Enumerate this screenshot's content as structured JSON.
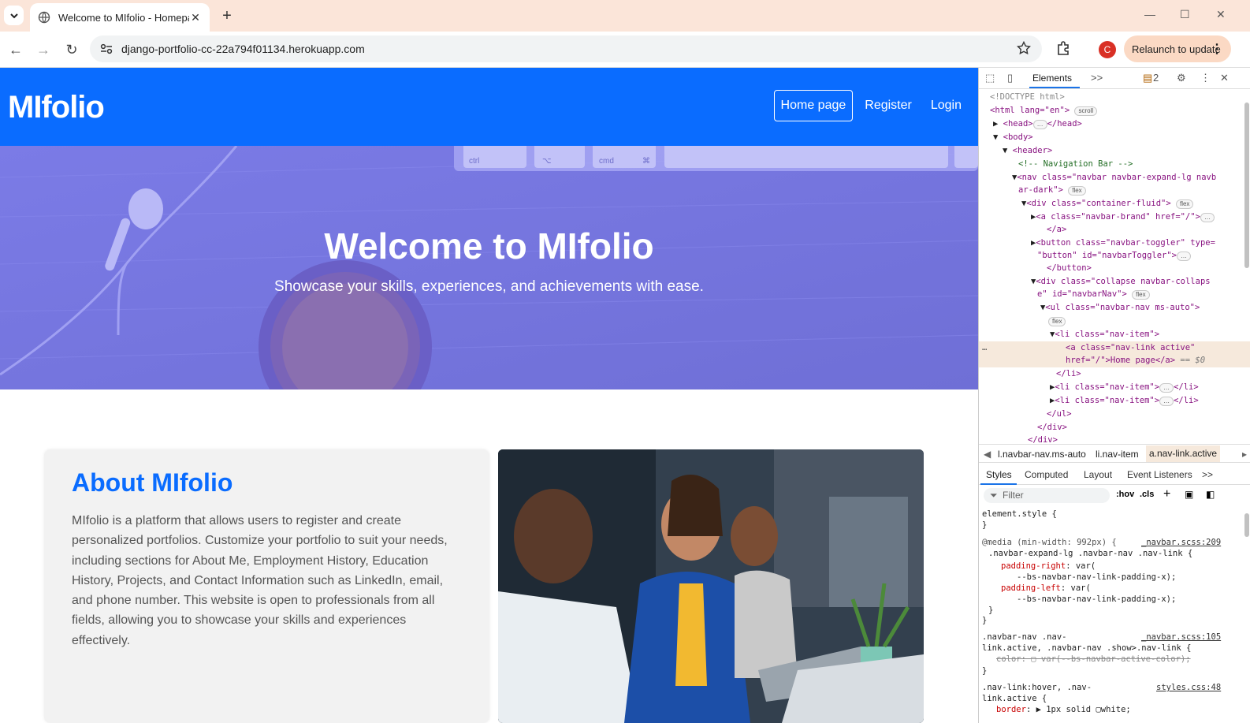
{
  "browser": {
    "tab_title": "Welcome to MIfolio - Homepag",
    "url": "django-portfolio-cc-22a794f01134.herokuapp.com",
    "relaunch_label": "Relaunch to update",
    "profile_initial": "C",
    "new_tab": "+",
    "close": "✕"
  },
  "site": {
    "brand": "MIfolio",
    "nav": [
      "Home page",
      "Register",
      "Login"
    ],
    "hero_title": "Welcome to MIfolio",
    "hero_subtitle": "Showcase your skills, experiences, and achievements with ease.",
    "about_title": "About MIfolio",
    "about_text": "MIfolio is a platform that allows users to register and create personalized portfolios. Customize your portfolio to suit your needs, including sections for About Me, Employment History, Education History, Projects, and Contact Information such as LinkedIn, email, and phone number. This website is open to professionals from all fields, allowing you to showcase your skills and experiences effectively."
  },
  "hero_keyboard": {
    "key1": "ctrl",
    "key2": "⌥",
    "key3": "cmd",
    "key3_symbol": "⌘"
  },
  "devtools": {
    "tab_elements": "Elements",
    "more": ">>",
    "issue_count": "2",
    "badges": {
      "scroll": "scroll",
      "flex": "flex"
    },
    "dom": {
      "doctype": "<!DOCTYPE html>",
      "html_open": "<html lang=\"en\">",
      "head": "<head>",
      "head_close": "</head>",
      "body": "<body>",
      "header": "<header>",
      "comment": "<!-- Navigation Bar -->",
      "nav_1": "<nav class=\"navbar navbar-expand-lg navb",
      "nav_2": "ar-dark\">",
      "div_container": "<div class=\"container-fluid\">",
      "a_brand": "<a class=\"navbar-brand\" href=\"/\">",
      "a_close": "</a>",
      "button_1": "<button class=\"navbar-toggler\" type=",
      "button_2": "\"button\" id=\"navbarToggler\">",
      "button_close": "</button>",
      "collapse_1": "<div class=\"collapse navbar-collaps",
      "collapse_2": "e\" id=\"navbarNav\">",
      "ul": "<ul class=\"navbar-nav ms-auto\">",
      "li": "<li class=\"nav-item\">",
      "a_active_1": "<a class=\"nav-link active\"",
      "a_active_2": "href=\"/\">Home page</a>",
      "eq_sel": "== $0",
      "li_close": "</li>",
      "li_collapsed": "<li class=\"nav-item\">",
      "li_collapsed_close": "</li>",
      "ul_close": "</ul>",
      "div_close": "</div>",
      "div_close2": "</div>"
    },
    "crumbs": [
      "l.navbar-nav.ms-auto",
      "li.nav-item",
      "a.nav-link.active"
    ],
    "subtabs": [
      "Styles",
      "Computed",
      "Layout",
      "Event Listeners",
      ">>"
    ],
    "filter_placeholder": "Filter",
    "hov": ":hov",
    "cls": ".cls",
    "styles": {
      "element_style": "element.style {",
      "close_brace": "}",
      "media": "@media (min-width: 992px) {",
      "media_src": "_navbar.scss:209",
      "sel1": ".navbar-expand-lg .navbar-nav .nav-link {",
      "pr": "padding-right",
      "pr_val": ": var(",
      "pr_var": "--bs-navbar-nav-link-padding-x);",
      "pl": "padding-left",
      "pl_val": ": var(",
      "pl_var": "--bs-navbar-nav-link-padding-x);",
      "sel2a": ".navbar-nav .nav-",
      "sel2_src": "_navbar.scss:105",
      "sel2b": "link.active, .navbar-nav .show>.nav-link {",
      "color_strike": "color: ",
      "color_strike_val": "var(--bs-navbar-active-color);",
      "sel3a": ".nav-link:hover, .nav-",
      "sel3_src": "styles.css:48",
      "sel3b": "link.active {",
      "border": "border",
      "border_val": ": ▶ 1px solid ",
      "border_col": "white;"
    }
  }
}
